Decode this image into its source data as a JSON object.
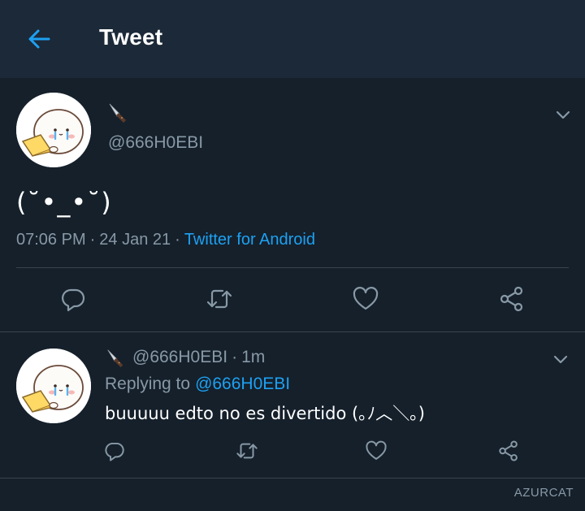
{
  "header": {
    "title": "Tweet",
    "back_icon": "arrow-left-icon",
    "accent": "#1da1f2"
  },
  "main_tweet": {
    "display_name_icon": "knife-emoji",
    "handle": "@666H0EBI",
    "text": "(˘•_•˘)",
    "time": "07:06 PM",
    "date": "24 Jan 21",
    "client": "Twitter for Android",
    "actions": [
      "reply-icon",
      "retweet-icon",
      "like-icon",
      "share-icon"
    ]
  },
  "reply_tweet": {
    "display_name_icon": "knife-emoji",
    "handle": "@666H0EBI",
    "age": "1m",
    "replying_label": "Replying to",
    "replying_to": "@666H0EBI",
    "text": "buuuuu edto no es divertido (｡ﾉ︿＼｡)",
    "actions": [
      "reply-icon",
      "retweet-icon",
      "like-icon",
      "share-icon"
    ]
  },
  "watermark": "AZURCAT",
  "colors": {
    "background": "#15202b",
    "header": "#1c2938",
    "secondary_text": "#8899a6",
    "divider": "#38444d"
  }
}
